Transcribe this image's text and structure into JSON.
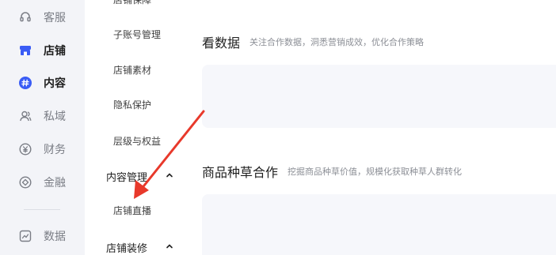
{
  "rail": {
    "items": [
      {
        "label": "客服",
        "icon": "headset-icon"
      },
      {
        "label": "店铺",
        "icon": "store-icon"
      },
      {
        "label": "内容",
        "icon": "hashtag-icon"
      },
      {
        "label": "私域",
        "icon": "users-icon"
      },
      {
        "label": "财务",
        "icon": "yen-icon"
      },
      {
        "label": "金融",
        "icon": "finance-icon"
      },
      {
        "label": "数据",
        "icon": "chart-icon"
      }
    ]
  },
  "submenu": {
    "cut_off_top": "店铺保障",
    "items": [
      "子账号管理",
      "店铺素材",
      "隐私保护",
      "层级与权益"
    ],
    "group_content": "内容管理",
    "content_items": [
      "店铺直播"
    ],
    "group_decor": "店铺装修"
  },
  "main": {
    "data_title": "看数据",
    "data_desc": "关注合作数据，洞悉营销成效，优化合作策略",
    "seed_title": "商品种草合作",
    "seed_desc": "挖掘商品种草价值，规模化获取种草人群转化"
  },
  "colors": {
    "accent": "#3a5cf5",
    "arrow": "#e8392b",
    "rail_bg": "#f3f4f8",
    "card_bg": "#f6f7fb"
  }
}
